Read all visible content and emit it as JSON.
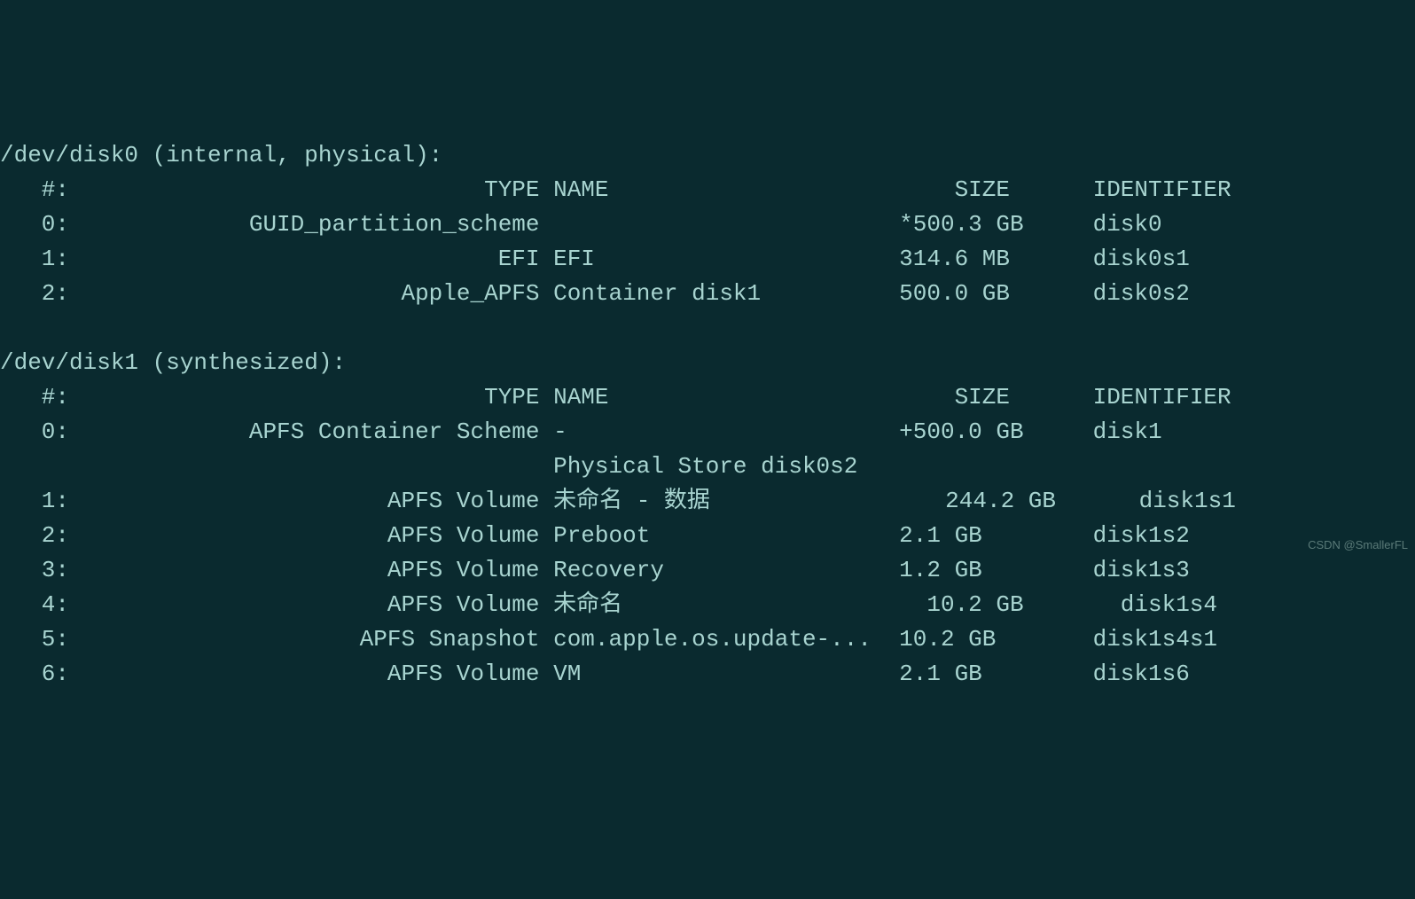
{
  "watermark": "CSDN @SmallerFL",
  "disk0": {
    "header": "/dev/disk0 (internal, physical):",
    "cols": {
      "idx": "#:",
      "type": "TYPE",
      "name": "NAME",
      "size": "SIZE",
      "ident": "IDENTIFIER"
    },
    "rows": [
      {
        "idx": "0:",
        "type": "GUID_partition_scheme",
        "name": "",
        "size": "*500.3 GB",
        "ident": "disk0"
      },
      {
        "idx": "1:",
        "type": "EFI",
        "name": "EFI",
        "size": "314.6 MB",
        "ident": "disk0s1"
      },
      {
        "idx": "2:",
        "type": "Apple_APFS",
        "name": "Container disk1",
        "size": "500.0 GB",
        "ident": "disk0s2"
      }
    ]
  },
  "disk1": {
    "header": "/dev/disk1 (synthesized):",
    "cols": {
      "idx": "#:",
      "type": "TYPE",
      "name": "NAME",
      "size": "SIZE",
      "ident": "IDENTIFIER"
    },
    "rows": [
      {
        "idx": "0:",
        "type": "APFS Container Scheme",
        "name": "-",
        "size": "+500.0 GB",
        "ident": "disk1"
      },
      {
        "idx": "",
        "type": "",
        "name": "Physical Store disk0s2",
        "size": "",
        "ident": ""
      },
      {
        "idx": "1:",
        "type": "APFS Volume",
        "name": "未命名 - 数据",
        "size": "244.2 GB",
        "ident": "disk1s1"
      },
      {
        "idx": "2:",
        "type": "APFS Volume",
        "name": "Preboot",
        "size": "2.1 GB",
        "ident": "disk1s2"
      },
      {
        "idx": "3:",
        "type": "APFS Volume",
        "name": "Recovery",
        "size": "1.2 GB",
        "ident": "disk1s3"
      },
      {
        "idx": "4:",
        "type": "APFS Volume",
        "name": "未命名",
        "size": "10.2 GB",
        "ident": "disk1s4"
      },
      {
        "idx": "5:",
        "type": "APFS Snapshot",
        "name": "com.apple.os.update-...",
        "size": "10.2 GB",
        "ident": "disk1s4s1"
      },
      {
        "idx": "6:",
        "type": "APFS Volume",
        "name": "VM",
        "size": "2.1 GB",
        "ident": "disk1s6"
      }
    ]
  }
}
